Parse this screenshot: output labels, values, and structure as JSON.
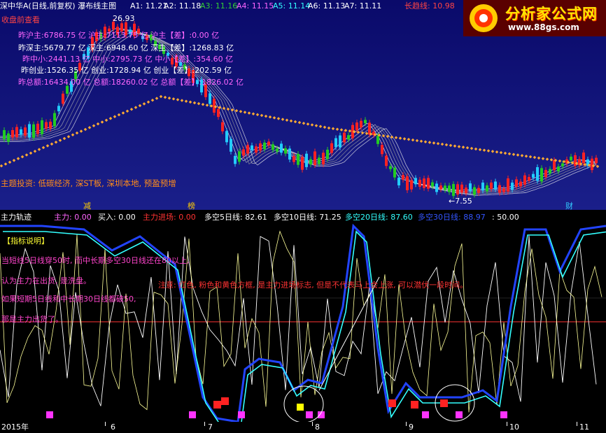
{
  "window_title": "深中华A(日线,前复权) 瀑布线主图",
  "ma_readouts": [
    {
      "label": "A1: 11.21",
      "color": "#ffffff"
    },
    {
      "label": "A2: 11.18",
      "color": "#ffffff"
    },
    {
      "label": "A3: 11.16",
      "color": "#33cc33"
    },
    {
      "label": "A4: 11.15",
      "color": "#ff66ff"
    },
    {
      "label": "A5: 11.14",
      "color": "#33ffff"
    },
    {
      "label": "A6: 11.13",
      "color": "#ffffff"
    },
    {
      "label": "A7: 11.11",
      "color": "#ffffff"
    },
    {
      "label": "长趋线: 10.98",
      "color": "#ff4444"
    }
  ],
  "logo": {
    "title": "分析家公式网",
    "url": "www.88gs.com"
  },
  "close_review_link": "收盘前查看",
  "price_high_label": "26.93",
  "price_low_label": "←7.55",
  "stats": [
    {
      "text": "昨沪主:6786.75 亿 沪主:7113.75 亿 沪主【差】:0.00 亿",
      "color": "#ff66ff"
    },
    {
      "text": "昨深主:5679.77 亿 深主:6948.60 亿 深主【差】:1268.83 亿",
      "color": "#ffffff"
    },
    {
      "text": "昨中小:2441.13 亿 中小:2795.73 亿 中小【差】:354.60 亿",
      "color": "#ff66ff"
    },
    {
      "text": "昨创业:1526.35 亿 创业:1728.94 亿 创业【差】:202.59 亿",
      "color": "#ffffff"
    },
    {
      "text": "昨总额:16434.00 亿 总额:18260.02 亿 总额【差】:1826.02 亿",
      "color": "#ff66ff"
    }
  ],
  "theme_text": "主题投资: 低碳经济, 深ST板, 深圳本地, 预盈预增",
  "event_markers": [
    {
      "label": "减",
      "color": "#ffcc00"
    },
    {
      "label": "榜",
      "color": "#ffcc00"
    },
    {
      "label": "财",
      "color": "#33ccff"
    }
  ],
  "indicator": {
    "name": "主力轨迹",
    "values": [
      {
        "text": "主力: 0.00",
        "color": "#ff66ff"
      },
      {
        "text": "买入: 0.00",
        "color": "#ffffff"
      },
      {
        "text": "主力进场: 0.00",
        "color": "#ff3333"
      },
      {
        "text": "多空5日线: 82.61",
        "color": "#ffffff"
      },
      {
        "text": "多空10日线: 71.25",
        "color": "#ffffff"
      },
      {
        "text": "多空20日线: 87.60",
        "color": "#33ffff"
      },
      {
        "text": "多空30日线: 88.97",
        "color": "#3355ff"
      },
      {
        "text": ": 50.00",
        "color": "#ffffff"
      }
    ]
  },
  "explanation": {
    "header": "【指标说明】",
    "lines": [
      "当短线5日线穿50时, 而中长期多空30日线还在80以上,",
      "认为主力在出货, 是洗盘。",
      "如果短期5日线和中长期30日线都破50,",
      "那是主力出货了。"
    ],
    "note": "注意: 红色, 粉色和黄色方框, 是主力进场标志, 但是不代表马上会上涨, 可以潜伏一段时间。"
  },
  "time_axis": [
    "2015年",
    "6",
    "7",
    "8",
    "9",
    "10",
    "11"
  ],
  "colors": {
    "up_candle": "#ff2222",
    "down_candle": "#22ccff",
    "green_candle": "#22cc22",
    "trend_dots": "#ffaa33",
    "panel_bg": "#12167a"
  }
}
